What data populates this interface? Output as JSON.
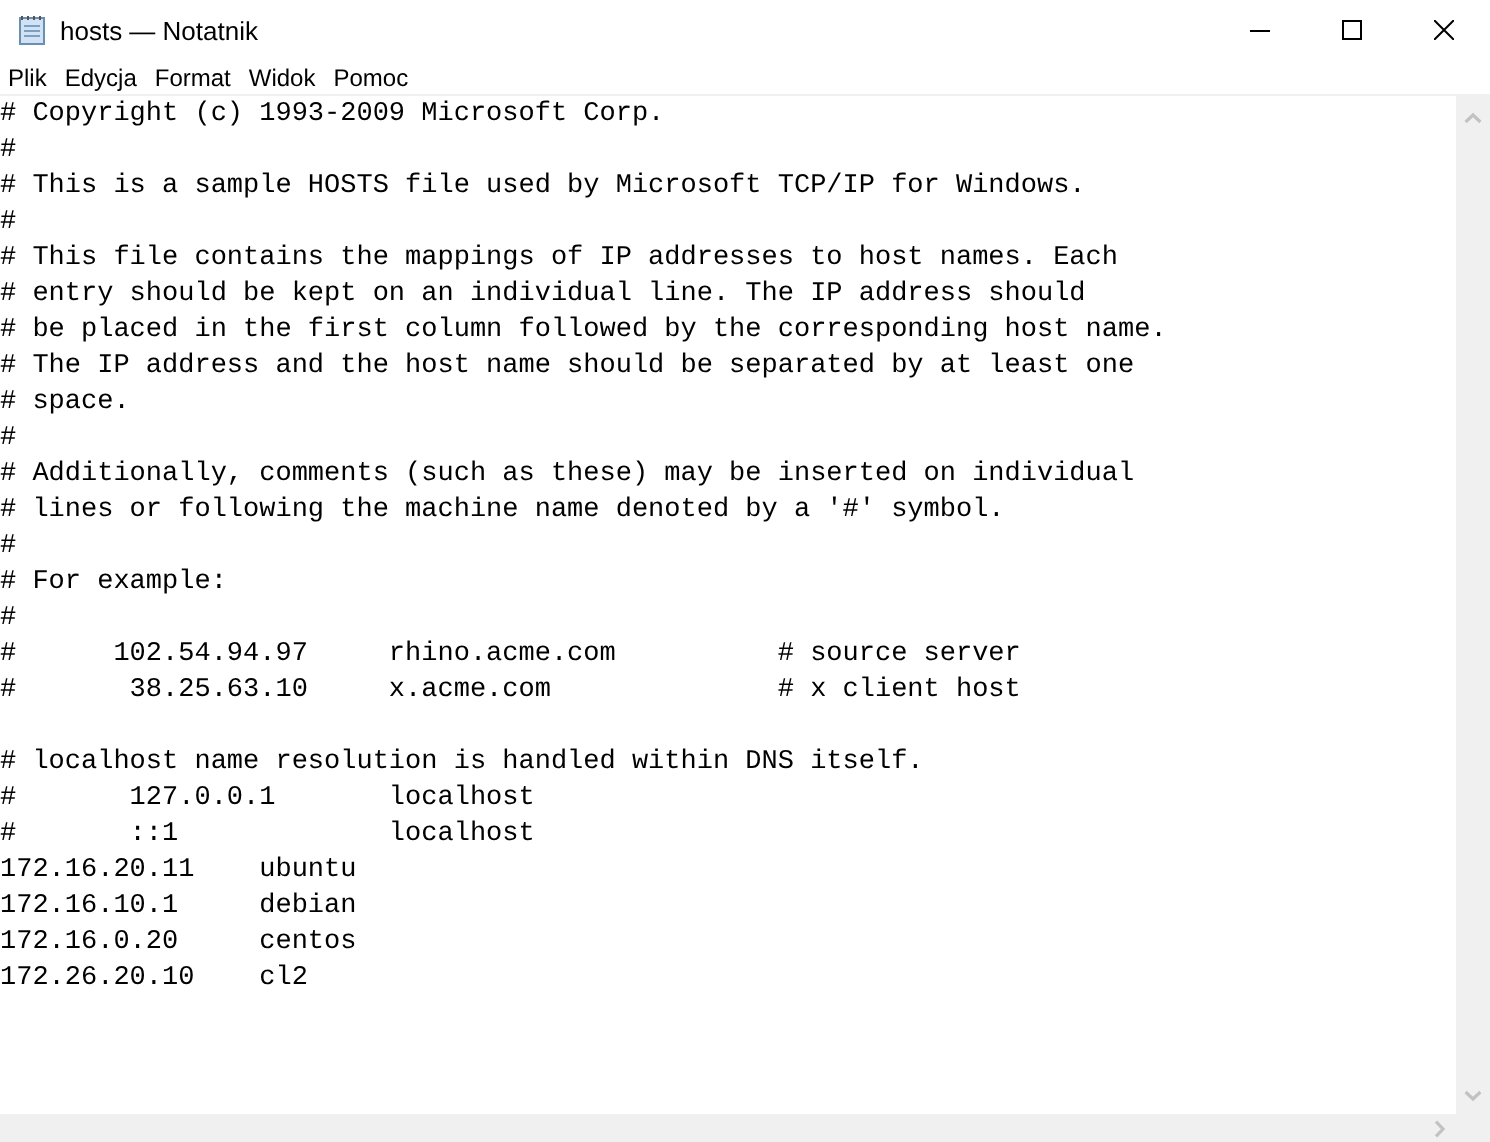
{
  "window": {
    "title": "hosts — Notatnik"
  },
  "menu": [
    {
      "label": "Plik"
    },
    {
      "label": "Edycja"
    },
    {
      "label": "Format"
    },
    {
      "label": "Widok"
    },
    {
      "label": "Pomoc"
    }
  ],
  "editor": {
    "lines": [
      {
        "kind": "text",
        "text": "# Copyright (c) 1993-2009 Microsoft Corp."
      },
      {
        "kind": "text",
        "text": "#"
      },
      {
        "kind": "text",
        "text": "# This is a sample HOSTS file used by Microsoft TCP/IP for Windows."
      },
      {
        "kind": "text",
        "text": "#"
      },
      {
        "kind": "text",
        "text": "# This file contains the mappings of IP addresses to host names. Each"
      },
      {
        "kind": "text",
        "text": "# entry should be kept on an individual line. The IP address should"
      },
      {
        "kind": "text",
        "text": "# be placed in the first column followed by the corresponding host name."
      },
      {
        "kind": "text",
        "text": "# The IP address and the host name should be separated by at least one"
      },
      {
        "kind": "text",
        "text": "# space."
      },
      {
        "kind": "text",
        "text": "#"
      },
      {
        "kind": "text",
        "text": "# Additionally, comments (such as these) may be inserted on individual"
      },
      {
        "kind": "text",
        "text": "# lines or following the machine name denoted by a '#' symbol."
      },
      {
        "kind": "text",
        "text": "#"
      },
      {
        "kind": "text",
        "text": "# For example:"
      },
      {
        "kind": "text",
        "text": "#"
      },
      {
        "kind": "text",
        "text": "#      102.54.94.97     rhino.acme.com          # source server"
      },
      {
        "kind": "text",
        "text": "#       38.25.63.10     x.acme.com              # x client host"
      },
      {
        "kind": "blank"
      },
      {
        "kind": "text",
        "text": "# localhost name resolution is handled within DNS itself."
      },
      {
        "kind": "text",
        "text": "#       127.0.0.1       localhost"
      },
      {
        "kind": "text",
        "text": "#       ::1             localhost"
      },
      {
        "kind": "text",
        "text": "172.16.20.11    ubuntu"
      },
      {
        "kind": "text",
        "text": "172.16.10.1     debian"
      },
      {
        "kind": "text",
        "text": "172.16.0.20     centos"
      },
      {
        "kind": "text",
        "text": "172.26.20.10    cl2"
      }
    ]
  }
}
